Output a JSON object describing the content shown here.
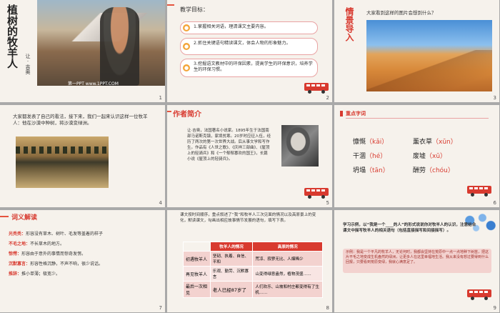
{
  "slide1": {
    "title_chars": [
      "植",
      "树",
      "的",
      "牧",
      "羊",
      "人"
    ],
    "author": "让·吉奥",
    "watermark": "第一PPT www.1PPT.COM",
    "number": "1"
  },
  "slide2": {
    "heading": "教学目标：",
    "items": [
      {
        "n": "1",
        "text": "1.掌握相关词语，理清课文主要内容。"
      },
      {
        "n": "2",
        "text": "2.抓住关键语句精读课文，体会人物的形象魅力。"
      },
      {
        "n": "3",
        "text": "3.挖掘语文教材中的环保因素，提高学生的环保意识，培养学生的环保习惯。"
      }
    ],
    "number": "2"
  },
  "slide3": {
    "title_chars": [
      "情",
      "景",
      "导",
      "入"
    ],
    "question": "大家看到这样的图片会想到什么？",
    "number": "3"
  },
  "slide4": {
    "text": "大家都发表了自己的看法，接下来，我们一起来认识这样一位牧羊人：他在沙漠中种树，将沙漠变绿洲。",
    "number": "4"
  },
  "slide5": {
    "title": "作者简介",
    "text": "让·吉奥，法国著名小说家。1895年生于法国南部马诺斯克镇，家境贫寒。20岁时应征入伍，经历了两次的第一次世界大战。后从事文学和写作生。作品有《人世之歌》、《庆祥三部曲》、《屋顶上的轻骑兵》和《一个郁郁寡欢的国王》，长篇小说《屋顶上的轻骑兵》。",
    "number": "5"
  },
  "slide6": {
    "title": "重点字词",
    "words": [
      {
        "w": "慷慨",
        "p": "（kǎi）"
      },
      {
        "w": "薰衣草",
        "p": "（xūn）"
      },
      {
        "w": "干涸",
        "p": "（hé）"
      },
      {
        "w": "废墟",
        "p": "（xū）"
      },
      {
        "w": "坍塌",
        "p": "（tān）"
      },
      {
        "w": "酬劳",
        "p": "（chóu）"
      }
    ],
    "number": "6"
  },
  "slide7": {
    "title": "词义解读",
    "entries": [
      {
        "term": "光秃秃：",
        "def": "形容没有草木、树叶、毛发等盖着的样子"
      },
      {
        "term": "不毛之地：",
        "def": "不长草木的地方。"
      },
      {
        "term": "惊愕：",
        "def": "形容由于意外的事情而惊奇发愣。"
      },
      {
        "term": "沉默寡言：",
        "def": "形容性格沉静，不声不响，很少说话。"
      },
      {
        "term": "推辞：",
        "def": "推小单薄；极宽少。"
      }
    ],
    "number": "7"
  },
  "slide8": {
    "intro": "课文按时间顺序，重点叙述了“我”和牧羊人三次见面的情况以及高原景上的变化，默读课文，勾画出相应故事情节发展的语句，填写下表。",
    "headers": [
      "",
      "牧羊人的情况",
      "高原的情况"
    ],
    "rows": [
      [
        "初遇牧羊人",
        "坚韧、执着、自信、平和",
        "荒凉、寂寥无比、人烟稀少"
      ],
      [
        "再见牧羊人",
        "乐观、勤劳、沉默寡言",
        "山变得绿意盎然，植物茂盛……"
      ],
      [
        "最后一次相见",
        "老人已经87岁了",
        "人们欢乐、山坡和村庄都变得有了生机……"
      ]
    ],
    "number": "8"
  },
  "slide9": {
    "lead": "学习示例，以“我是一个____的人”的形式说说你对牧羊人的认识，注意结合课文中描写牧羊人的相关语句（包括直接描写和间接描写）。",
    "example": "示例：我是一个平凡的牧羊人，无论何时，我都会坚持在荒原中一点一点地种下树苗，把这片不毛之地变成生机盎然的绿洲，让更多人在这里幸福地生活。我从来没有想过要得到什么回报，只要看到荒原变绿，我就心满意足了。",
    "number": "9"
  },
  "colors": {
    "accent": "#d83a2f",
    "orange": "#f3a53a",
    "bg": "#f6f2ec"
  }
}
